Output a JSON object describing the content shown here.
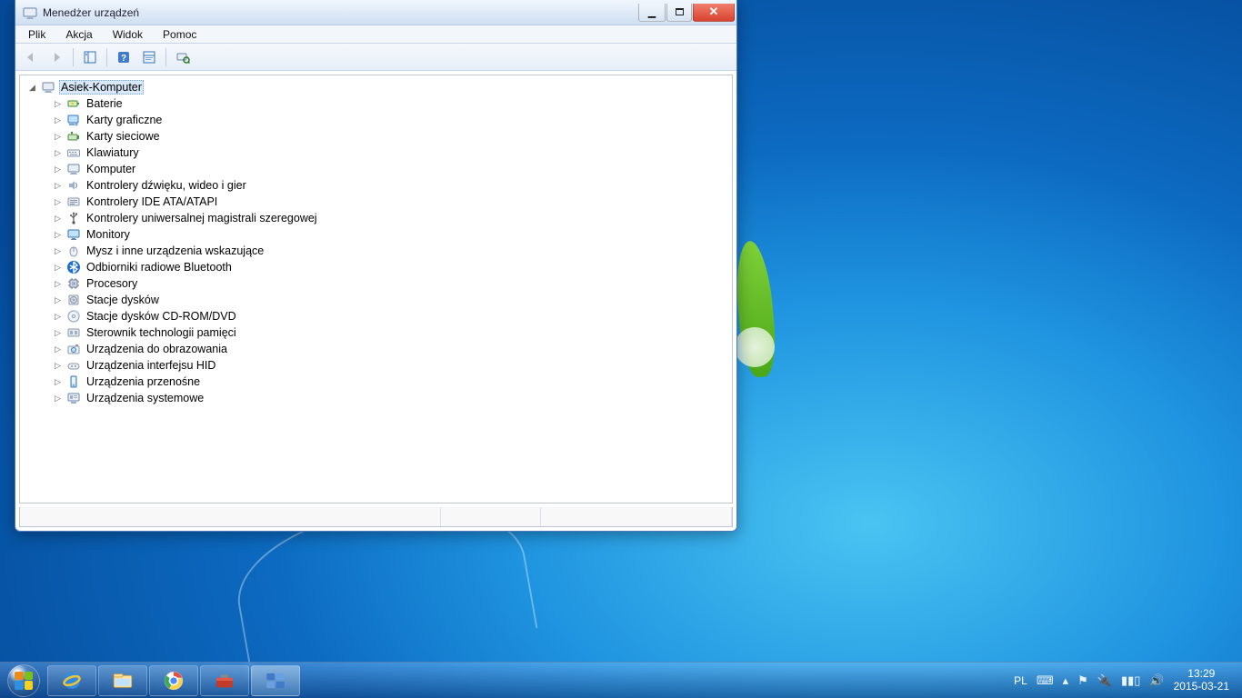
{
  "window": {
    "title": "Menedżer urządzeń",
    "menus": [
      "Plik",
      "Akcja",
      "Widok",
      "Pomoc"
    ]
  },
  "tree": {
    "root": {
      "label": "Asiek-Komputer",
      "icon": "computer"
    },
    "children": [
      {
        "label": "Baterie",
        "icon": "battery"
      },
      {
        "label": "Karty graficzne",
        "icon": "display-adapter"
      },
      {
        "label": "Karty sieciowe",
        "icon": "network-adapter"
      },
      {
        "label": "Klawiatury",
        "icon": "keyboard"
      },
      {
        "label": "Komputer",
        "icon": "computer"
      },
      {
        "label": "Kontrolery dźwięku, wideo i gier",
        "icon": "sound"
      },
      {
        "label": "Kontrolery IDE ATA/ATAPI",
        "icon": "ide"
      },
      {
        "label": "Kontrolery uniwersalnej magistrali szeregowej",
        "icon": "usb"
      },
      {
        "label": "Monitory",
        "icon": "monitor"
      },
      {
        "label": "Mysz i inne urządzenia wskazujące",
        "icon": "mouse"
      },
      {
        "label": "Odbiorniki radiowe Bluetooth",
        "icon": "bluetooth"
      },
      {
        "label": "Procesory",
        "icon": "processor"
      },
      {
        "label": "Stacje dysków",
        "icon": "disk"
      },
      {
        "label": "Stacje dysków CD-ROM/DVD",
        "icon": "optical"
      },
      {
        "label": "Sterownik technologii pamięci",
        "icon": "storage-controller"
      },
      {
        "label": "Urządzenia do obrazowania",
        "icon": "imaging"
      },
      {
        "label": "Urządzenia interfejsu HID",
        "icon": "hid"
      },
      {
        "label": "Urządzenia przenośne",
        "icon": "portable"
      },
      {
        "label": "Urządzenia systemowe",
        "icon": "system"
      }
    ]
  },
  "tray": {
    "lang": "PL",
    "time": "13:29",
    "date": "2015-03-21"
  }
}
